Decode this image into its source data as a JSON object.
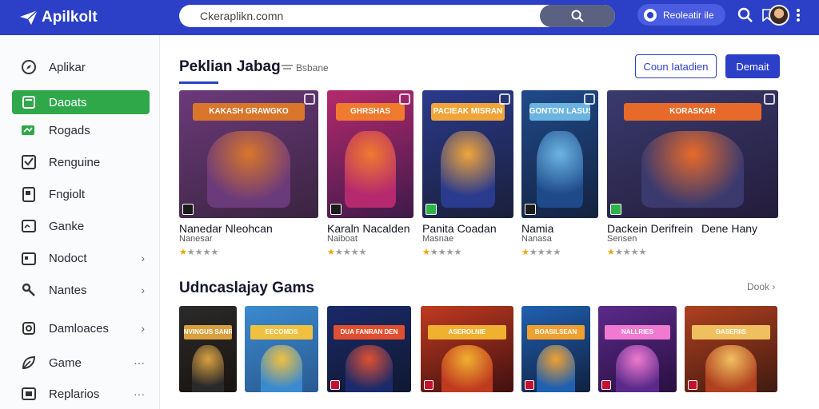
{
  "header": {
    "logo_text": "Apilkolt",
    "search": {
      "value": "Ckeraplikn.comn",
      "placeholder": ""
    },
    "pill_label": "Reoleatir ile",
    "icons": [
      "paper-plane-logo-icon",
      "search-icon",
      "search-icon",
      "avatar",
      "more-vertical-icon"
    ]
  },
  "sidebar": {
    "items": [
      {
        "label": "Aplikar",
        "icon": "compass-icon",
        "active": false,
        "trail": ""
      },
      {
        "label": "Daoats",
        "icon": "square-icon",
        "active": true,
        "trail": ""
      },
      {
        "label": "Rogads",
        "icon": "gamepad-icon",
        "active": false,
        "trail": ""
      },
      {
        "label": "Renguine",
        "icon": "checkbox-icon",
        "active": false,
        "trail": ""
      },
      {
        "label": "Fngiolt",
        "icon": "document-icon",
        "active": false,
        "trail": ""
      },
      {
        "label": "Ganke",
        "icon": "chart-icon",
        "active": false,
        "trail": ""
      },
      {
        "label": "Nodoct",
        "icon": "calendar-icon",
        "active": false,
        "trail": "›"
      },
      {
        "label": "Nantes",
        "icon": "tools-icon",
        "active": false,
        "trail": "›"
      },
      {
        "label": "Damloaces",
        "icon": "camera-icon",
        "active": false,
        "trail": "›"
      },
      {
        "label": "Game",
        "icon": "leaf-icon",
        "active": false,
        "trail": "···"
      },
      {
        "label": "Replarios",
        "icon": "window-icon",
        "active": false,
        "trail": "···"
      }
    ]
  },
  "featured": {
    "title": "Peklian Jabag",
    "sub_label": "Bsbane",
    "button_outline": "Coun Iatadien",
    "button_solid": "Demait",
    "cards": [
      {
        "title": "Nanedar Nleohcan",
        "subtitle": "Nanesar",
        "rating": 1,
        "poster_text": "KAKASH GRAWGKO",
        "colors": [
          "#6b3a7a",
          "#d9762b",
          "#3a2440"
        ],
        "badge": "dark"
      },
      {
        "title": "Karaln Nacalden",
        "subtitle": "Naiboat",
        "rating": 1,
        "poster_text": "GHRSHAS",
        "colors": [
          "#b5296e",
          "#f07a2e",
          "#3e1a4a"
        ],
        "badge": "dark"
      },
      {
        "title": "Panita Coadan",
        "subtitle": "Masnae",
        "rating": 1,
        "poster_text": "PACIEAK MISRAN",
        "colors": [
          "#2a3a8c",
          "#f0a53a",
          "#1a1f3a"
        ],
        "badge": "green"
      },
      {
        "title": "Namia",
        "subtitle": "Nanasa",
        "rating": 1,
        "poster_text": "GONTON LASUS",
        "colors": [
          "#1f4a8a",
          "#6bb4e0",
          "#142240"
        ],
        "badge": "dark"
      },
      {
        "title": "Dackein Derifrein",
        "subtitle": "Sensen",
        "rating": 1,
        "poster_text": "KORASKAR",
        "colors": [
          "#3a3a6e",
          "#e86a2a",
          "#241c3a"
        ],
        "badge": "green"
      },
      {
        "title": "Dene Hany",
        "subtitle": "",
        "rating": null,
        "poster_text": "",
        "colors": [],
        "badge": ""
      }
    ]
  },
  "upcoming": {
    "title": "Udncaslajay Gams",
    "more_link": "Dook ›",
    "thumbs": [
      {
        "poster_text": "NVINGUS SANR",
        "colors": [
          "#2a2a2a",
          "#d9a040",
          "#1a1410"
        ]
      },
      {
        "poster_text": "EECOMDS",
        "colors": [
          "#3a8ad0",
          "#f0c040",
          "#2a5a90"
        ]
      },
      {
        "poster_text": "DUA FANRAN DEN",
        "colors": [
          "#1a2a6a",
          "#e05030",
          "#101830"
        ]
      },
      {
        "poster_text": "ASEROLNIE",
        "colors": [
          "#c03a20",
          "#f0b030",
          "#401010"
        ]
      },
      {
        "poster_text": "BOASILSEAN",
        "colors": [
          "#2060b0",
          "#f0a030",
          "#102040"
        ]
      },
      {
        "poster_text": "NALLRIES",
        "colors": [
          "#5a2a8a",
          "#f07ad0",
          "#2a1040"
        ]
      },
      {
        "poster_text": "DASERIIS",
        "colors": [
          "#b04020",
          "#f0c060",
          "#401a10"
        ]
      }
    ]
  },
  "colors": {
    "brand": "#2b3fc7",
    "active": "#2fa84a",
    "star": "#f0a500"
  }
}
